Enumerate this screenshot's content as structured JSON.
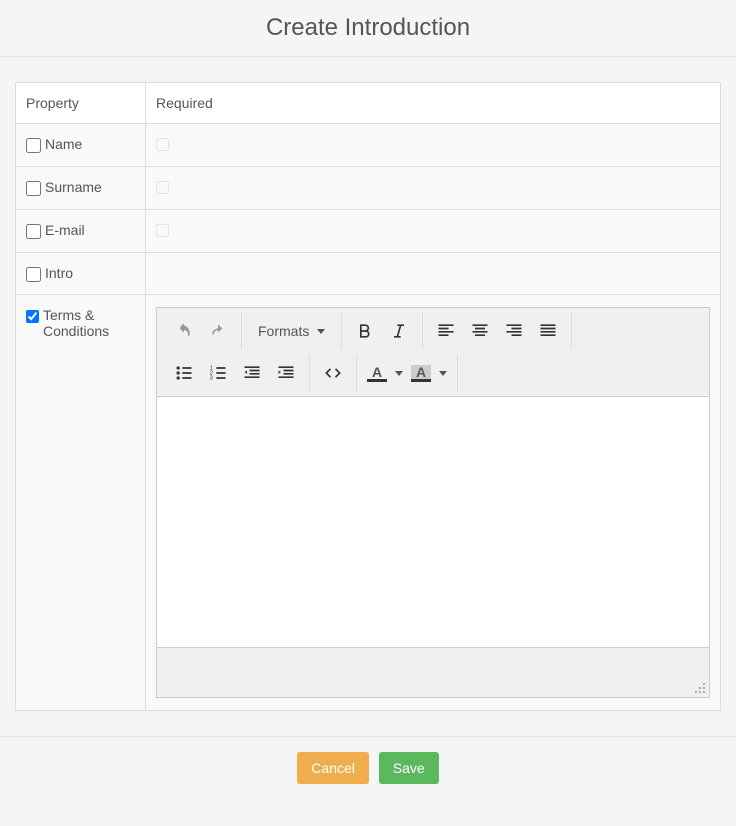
{
  "header": {
    "title": "Create Introduction"
  },
  "table": {
    "headers": {
      "property": "Property",
      "required": "Required"
    },
    "rows": [
      {
        "label": "Name",
        "prop_checked": false,
        "req_visible": true,
        "req_checked": false
      },
      {
        "label": "Surname",
        "prop_checked": false,
        "req_visible": true,
        "req_checked": false
      },
      {
        "label": "E-mail",
        "prop_checked": false,
        "req_visible": true,
        "req_checked": false
      },
      {
        "label": "Intro",
        "prop_checked": false,
        "req_visible": false,
        "req_checked": false
      },
      {
        "label": "Terms & Conditions",
        "prop_checked": true,
        "req_visible": false,
        "req_checked": false,
        "editor": true
      }
    ]
  },
  "editor": {
    "formats_label": "Formats",
    "text_color_letter": "A",
    "bg_color_letter": "A"
  },
  "footer": {
    "cancel": "Cancel",
    "save": "Save"
  }
}
